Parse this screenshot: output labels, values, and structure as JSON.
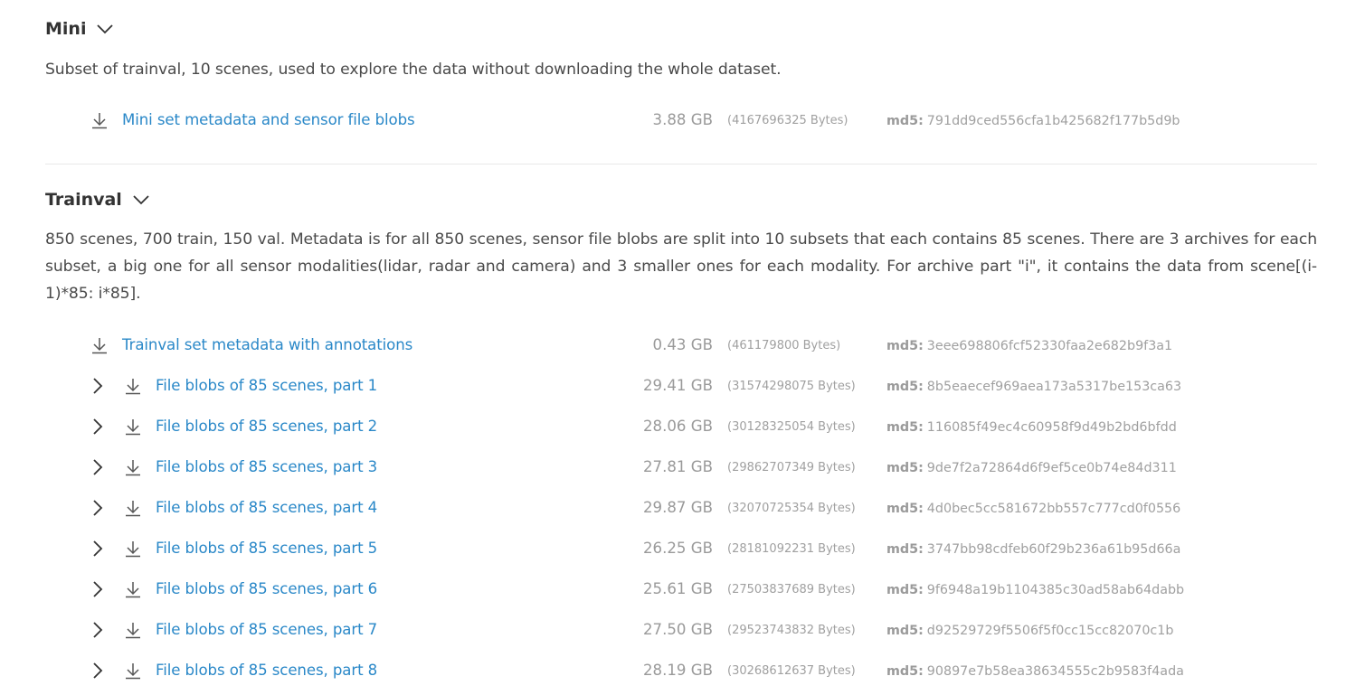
{
  "mini": {
    "title": "Mini",
    "description": "Subset of trainval, 10 scenes, used to explore the data without downloading the whole dataset.",
    "files": [
      {
        "label": "Mini set metadata and sensor file blobs",
        "size": "3.88 GB",
        "bytes": "(4167696325 Bytes)",
        "md5_label": "md5:",
        "md5": "791dd9ced556cfa1b425682f177b5d9b"
      }
    ]
  },
  "trainval": {
    "title": "Trainval",
    "description": "850 scenes, 700 train, 150 val. Metadata is for all 850 scenes, sensor file blobs are split into 10 subsets that each contains 85 scenes. There are 3 archives for each subset, a big one for all sensor modalities(lidar, radar and camera) and 3 smaller ones for each modality. For archive part \"i\", it contains the data from scene[(i-1)*85: i*85].",
    "metadata": {
      "label": "Trainval set metadata with annotations",
      "size": "0.43 GB",
      "bytes": "(461179800 Bytes)",
      "md5_label": "md5:",
      "md5": "3eee698806fcf52330faa2e682b9f3a1"
    },
    "parts": [
      {
        "label": "File blobs of 85 scenes, part 1",
        "size": "29.41 GB",
        "bytes": "(31574298075 Bytes)",
        "md5_label": "md5:",
        "md5": "8b5eaecef969aea173a5317be153ca63"
      },
      {
        "label": "File blobs of 85 scenes, part 2",
        "size": "28.06 GB",
        "bytes": "(30128325054 Bytes)",
        "md5_label": "md5:",
        "md5": "116085f49ec4c60958f9d49b2bd6bfdd"
      },
      {
        "label": "File blobs of 85 scenes, part 3",
        "size": "27.81 GB",
        "bytes": "(29862707349 Bytes)",
        "md5_label": "md5:",
        "md5": "9de7f2a72864d6f9ef5ce0b74e84d311"
      },
      {
        "label": "File blobs of 85 scenes, part 4",
        "size": "29.87 GB",
        "bytes": "(32070725354 Bytes)",
        "md5_label": "md5:",
        "md5": "4d0bec5cc581672bb557c777cd0f0556"
      },
      {
        "label": "File blobs of 85 scenes, part 5",
        "size": "26.25 GB",
        "bytes": "(28181092231 Bytes)",
        "md5_label": "md5:",
        "md5": "3747bb98cdfeb60f29b236a61b95d66a"
      },
      {
        "label": "File blobs of 85 scenes, part 6",
        "size": "25.61 GB",
        "bytes": "(27503837689 Bytes)",
        "md5_label": "md5:",
        "md5": "9f6948a19b1104385c30ad58ab64dabb"
      },
      {
        "label": "File blobs of 85 scenes, part 7",
        "size": "27.50 GB",
        "bytes": "(29523743832 Bytes)",
        "md5_label": "md5:",
        "md5": "d92529729f5506f5f0cc15cc82070c1b"
      },
      {
        "label": "File blobs of 85 scenes, part 8",
        "size": "28.19 GB",
        "bytes": "(30268612637 Bytes)",
        "md5_label": "md5:",
        "md5": "90897e7b58ea38634555c2b9583f4ada"
      }
    ]
  },
  "icons": {
    "section_toggle": "chevron-down-icon",
    "row_expand": "chevron-right-icon",
    "download": "download-icon"
  },
  "colors": {
    "link": "#2a88c8",
    "text": "#333333",
    "muted": "#a0a0a0",
    "divider": "#e8e8e8"
  }
}
